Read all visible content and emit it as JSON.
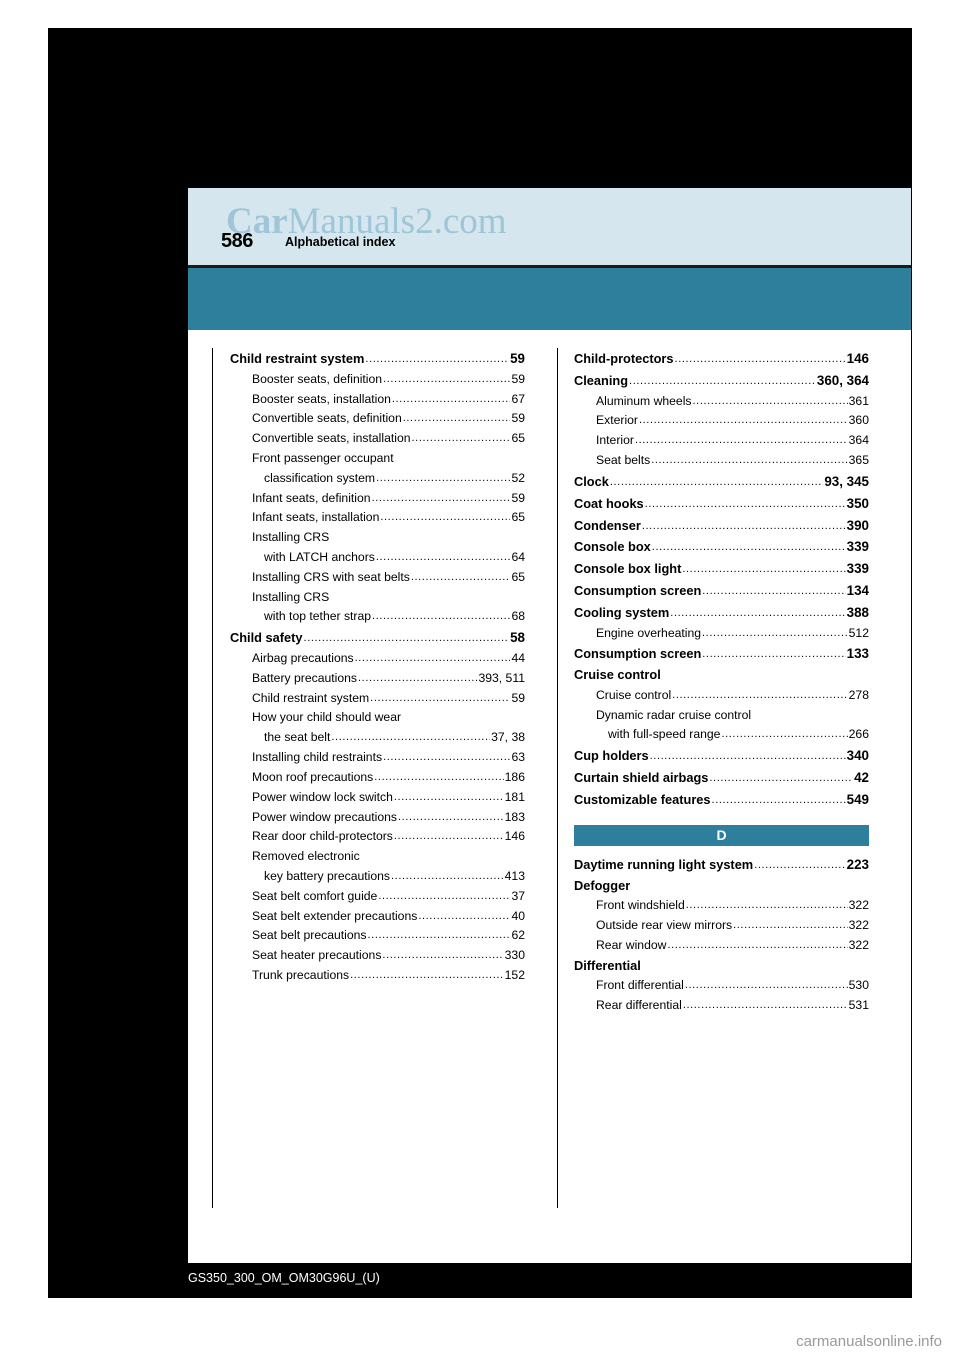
{
  "document": {
    "page_number": "586",
    "header_title": "Alphabetical index",
    "footer": "GS350_300_OM_OM30G96U_(U)",
    "watermark": "CarManuals2.com",
    "site_credit": "carmanualsonline.info"
  },
  "columns": {
    "left": [
      {
        "level": 1,
        "bold": true,
        "text": "Child restraint system",
        "page": "59"
      },
      {
        "level": 2,
        "bold": false,
        "text": "Booster seats, definition",
        "page": "59"
      },
      {
        "level": 2,
        "bold": false,
        "text": "Booster seats, installation",
        "page": "67"
      },
      {
        "level": 2,
        "bold": false,
        "text": "Convertible seats, definition",
        "page": "59"
      },
      {
        "level": 2,
        "bold": false,
        "text": "Convertible seats, installation",
        "page": "65"
      },
      {
        "level": 2,
        "bold": false,
        "text": "Front passenger occupant",
        "page": "",
        "nodots": true
      },
      {
        "level": 3,
        "bold": false,
        "text": "classification system",
        "page": "52"
      },
      {
        "level": 2,
        "bold": false,
        "text": "Infant seats, definition",
        "page": "59"
      },
      {
        "level": 2,
        "bold": false,
        "text": "Infant seats, installation",
        "page": "65"
      },
      {
        "level": 2,
        "bold": false,
        "text": "Installing CRS",
        "page": "",
        "nodots": true
      },
      {
        "level": 3,
        "bold": false,
        "text": "with LATCH anchors",
        "page": "64"
      },
      {
        "level": 2,
        "bold": false,
        "text": "Installing CRS with seat belts",
        "page": "65"
      },
      {
        "level": 2,
        "bold": false,
        "text": "Installing CRS",
        "page": "",
        "nodots": true
      },
      {
        "level": 3,
        "bold": false,
        "text": "with top tether strap",
        "page": "68"
      },
      {
        "level": 1,
        "bold": true,
        "text": "Child safety",
        "page": "58"
      },
      {
        "level": 2,
        "bold": false,
        "text": "Airbag precautions",
        "page": "44"
      },
      {
        "level": 2,
        "bold": false,
        "text": "Battery precautions",
        "page": "393, 511"
      },
      {
        "level": 2,
        "bold": false,
        "text": "Child restraint system",
        "page": "59"
      },
      {
        "level": 2,
        "bold": false,
        "text": "How your child should wear",
        "page": "",
        "nodots": true
      },
      {
        "level": 3,
        "bold": false,
        "text": "the seat belt",
        "page": "37, 38"
      },
      {
        "level": 2,
        "bold": false,
        "text": "Installing child restraints",
        "page": "63"
      },
      {
        "level": 2,
        "bold": false,
        "text": "Moon roof precautions",
        "page": "186"
      },
      {
        "level": 2,
        "bold": false,
        "text": "Power window lock switch",
        "page": "181"
      },
      {
        "level": 2,
        "bold": false,
        "text": "Power window precautions",
        "page": "183"
      },
      {
        "level": 2,
        "bold": false,
        "text": "Rear door child-protectors",
        "page": "146"
      },
      {
        "level": 2,
        "bold": false,
        "text": "Removed electronic",
        "page": "",
        "nodots": true
      },
      {
        "level": 3,
        "bold": false,
        "text": "key battery precautions",
        "page": "413"
      },
      {
        "level": 2,
        "bold": false,
        "text": "Seat belt comfort guide",
        "page": "37"
      },
      {
        "level": 2,
        "bold": false,
        "text": "Seat belt extender precautions",
        "page": "40"
      },
      {
        "level": 2,
        "bold": false,
        "text": "Seat belt precautions",
        "page": "62"
      },
      {
        "level": 2,
        "bold": false,
        "text": "Seat heater precautions",
        "page": "330"
      },
      {
        "level": 2,
        "bold": false,
        "text": "Trunk precautions",
        "page": "152"
      }
    ],
    "right_before_letter": [
      {
        "level": 1,
        "bold": true,
        "text": "Child-protectors",
        "page": "146"
      },
      {
        "level": 1,
        "bold": true,
        "text": "Cleaning",
        "page": "360, 364"
      },
      {
        "level": 2,
        "bold": false,
        "text": "Aluminum wheels",
        "page": "361"
      },
      {
        "level": 2,
        "bold": false,
        "text": "Exterior",
        "page": "360"
      },
      {
        "level": 2,
        "bold": false,
        "text": "Interior",
        "page": "364"
      },
      {
        "level": 2,
        "bold": false,
        "text": "Seat belts",
        "page": "365"
      },
      {
        "level": 1,
        "bold": true,
        "text": "Clock",
        "page": "93, 345"
      },
      {
        "level": 1,
        "bold": true,
        "text": "Coat hooks",
        "page": "350"
      },
      {
        "level": 1,
        "bold": true,
        "text": "Condenser",
        "page": "390"
      },
      {
        "level": 1,
        "bold": true,
        "text": "Console box",
        "page": "339"
      },
      {
        "level": 1,
        "bold": true,
        "text": "Console box light",
        "page": "339"
      },
      {
        "level": 1,
        "bold": true,
        "text": "Consumption screen",
        "page": "134"
      },
      {
        "level": 1,
        "bold": true,
        "text": "Cooling system",
        "page": "388"
      },
      {
        "level": 2,
        "bold": false,
        "text": "Engine overheating",
        "page": "512"
      },
      {
        "level": 1,
        "bold": true,
        "text": "Consumption screen",
        "page": "133"
      },
      {
        "level": 1,
        "bold": true,
        "text": "Cruise control",
        "page": "",
        "nodots": true
      },
      {
        "level": 2,
        "bold": false,
        "text": "Cruise control",
        "page": "278"
      },
      {
        "level": 2,
        "bold": false,
        "text": "Dynamic radar cruise control",
        "page": "",
        "nodots": true
      },
      {
        "level": 3,
        "bold": false,
        "text": "with full-speed range",
        "page": "266"
      },
      {
        "level": 1,
        "bold": true,
        "text": "Cup holders",
        "page": "340"
      },
      {
        "level": 1,
        "bold": true,
        "text": "Curtain shield airbags",
        "page": "42"
      },
      {
        "level": 1,
        "bold": true,
        "text": "Customizable features",
        "page": "549"
      }
    ],
    "letter_heading": "D",
    "right_after_letter": [
      {
        "level": 1,
        "bold": true,
        "text": "Daytime running light system",
        "page": "223"
      },
      {
        "level": 1,
        "bold": true,
        "text": "Defogger",
        "page": "",
        "nodots": true
      },
      {
        "level": 2,
        "bold": false,
        "text": "Front windshield",
        "page": "322"
      },
      {
        "level": 2,
        "bold": false,
        "text": "Outside rear view mirrors",
        "page": "322"
      },
      {
        "level": 2,
        "bold": false,
        "text": "Rear window",
        "page": "322"
      },
      {
        "level": 1,
        "bold": true,
        "text": "Differential",
        "page": "",
        "nodots": true
      },
      {
        "level": 2,
        "bold": false,
        "text": "Front differential",
        "page": "530"
      },
      {
        "level": 2,
        "bold": false,
        "text": "Rear differential",
        "page": "531"
      }
    ]
  },
  "colors": {
    "teal": "#2e7f9c",
    "header_blue": "#d5e6ee",
    "watermark": "#9fc6d8"
  }
}
